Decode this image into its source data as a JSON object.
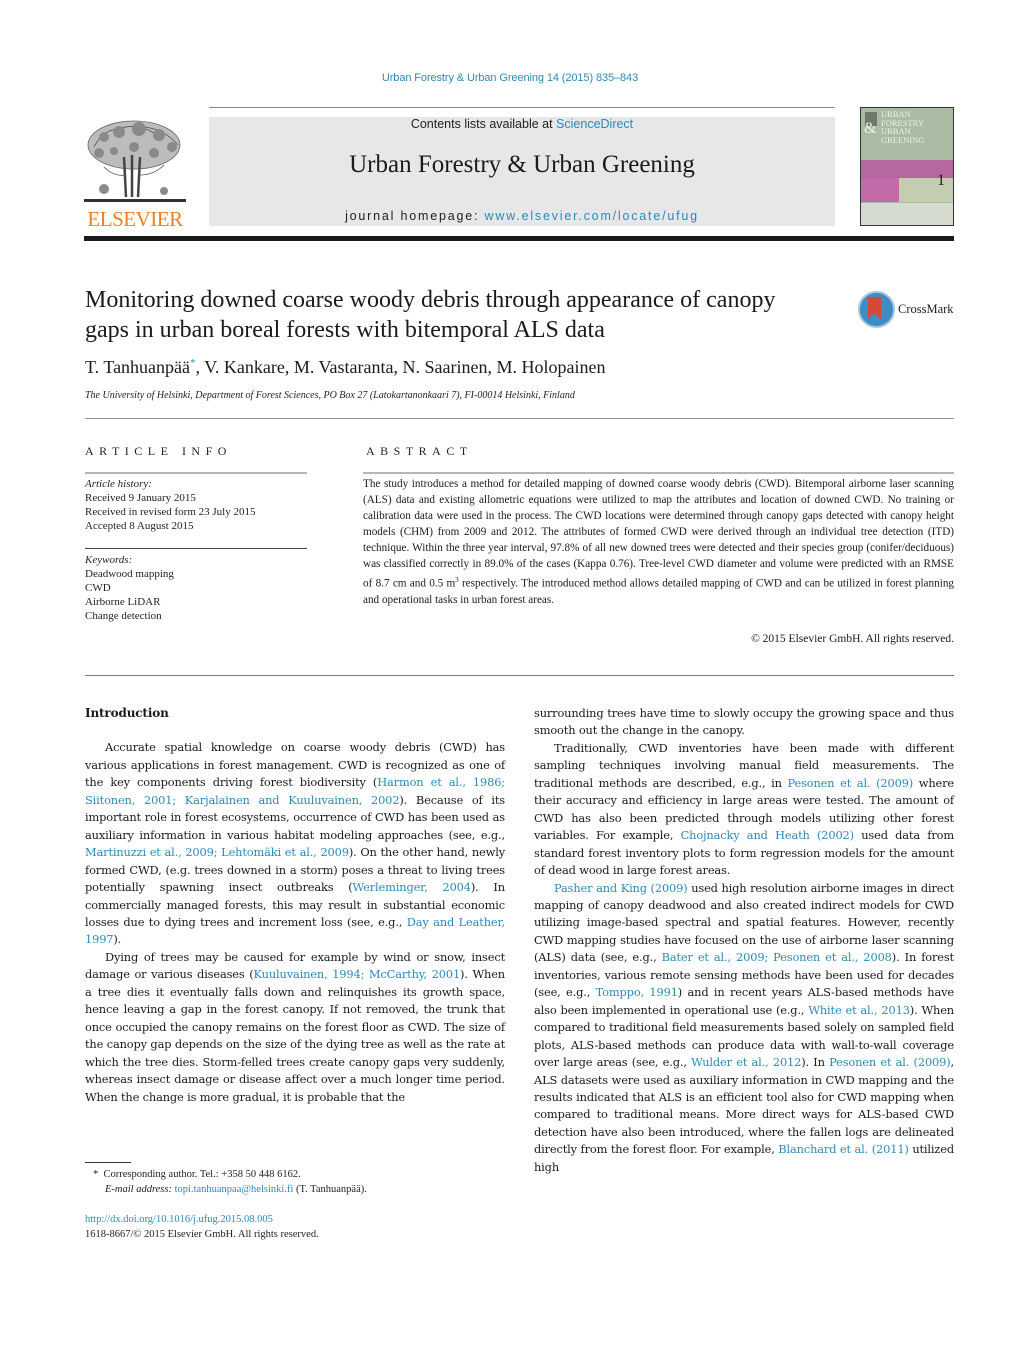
{
  "journal_ref": "Urban Forestry & Urban Greening 14 (2015) 835–843",
  "publisher": {
    "logo_word": "ELSEVIER",
    "brand_color": "#f07f1e"
  },
  "banner": {
    "contents_prefix": "Contents lists available at ",
    "contents_link": "ScienceDirect",
    "journal_title": "Urban Forestry & Urban Greening",
    "homepage_prefix": "journal homepage: ",
    "homepage_link": "www.elsevier.com/locate/ufug"
  },
  "cover": {
    "title_lines": [
      "URBAN",
      "FORESTRY",
      "URBAN",
      "GREENING"
    ],
    "amp": "&",
    "issue_number": "1"
  },
  "crossmark": {
    "label": "CrossMark"
  },
  "article": {
    "title": "Monitoring downed coarse woody debris through appearance of canopy gaps in urban boreal forests with bitemporal ALS data",
    "authors": [
      {
        "name": "T. Tanhuanpää",
        "corresponding": true
      },
      {
        "name": "V. Kankare"
      },
      {
        "name": "M. Vastaranta"
      },
      {
        "name": "N. Saarinen"
      },
      {
        "name": "M. Holopainen"
      }
    ],
    "authors_line_first": "T. Tanhuanpää",
    "authors_star": "*",
    "authors_line_rest": ", V. Kankare, M. Vastaranta, N. Saarinen, M. Holopainen",
    "affiliation": "The University of Helsinki, Department of Forest Sciences, PO Box 27 (Latokartanonkaari 7), FI-00014 Helsinki, Finland"
  },
  "article_info": {
    "heading": "ARTICLE INFO",
    "history_label": "Article history:",
    "history": [
      "Received 9 January 2015",
      "Received in revised form 23 July 2015",
      "Accepted 8 August 2015"
    ],
    "keywords_label": "Keywords:",
    "keywords": [
      "Deadwood mapping",
      "CWD",
      "Airborne LiDAR",
      "Change detection"
    ]
  },
  "abstract": {
    "heading": "ABSTRACT",
    "text_part1": "The study introduces a method for detailed mapping of downed coarse woody debris (CWD). Bitemporal airborne laser scanning (ALS) data and existing allometric equations were utilized to map the attributes and location of downed CWD. No training or calibration data were used in the process. The CWD locations were determined through canopy gaps detected with canopy height models (CHM) from 2009 and 2012. The attributes of formed CWD were derived through an individual tree detection (ITD) technique. Within the three year interval, 97.8% of all new downed trees were detected and their species group (conifer/deciduous) was classified correctly in 89.0% of the cases (Kappa 0.76). Tree-level CWD diameter and volume were predicted with an RMSE of 8.7 cm and 0.5 m",
    "superscript": "3",
    "text_part2": " respectively. The introduced method allows detailed mapping of CWD and can be utilized in forest planning and operational tasks in urban forest areas.",
    "copyright": "© 2015 Elsevier GmbH. All rights reserved."
  },
  "body": {
    "intro_heading": "Introduction",
    "left": [
      [
        {
          "t": "Accurate spatial knowledge on coarse woody debris (CWD) has various applications in forest management. CWD is recognized as one of the key components driving forest biodiversity ("
        },
        {
          "t": "Harmon et al., 1986; Siitonen, 2001; Karjalainen and Kuuluvainen, 2002",
          "link": true
        },
        {
          "t": "). Because of its important role in forest ecosystems, occurrence of CWD has been used as auxiliary information in various habitat modeling approaches (see, e.g., "
        },
        {
          "t": "Martinuzzi et al., 2009; Lehtomäki et al., 2009",
          "link": true
        },
        {
          "t": "). On the other hand, newly formed CWD, (e.g. trees downed in a storm) poses a threat to living trees potentially spawning insect outbreaks ("
        },
        {
          "t": "Werleminger, 2004",
          "link": true
        },
        {
          "t": "). In commercially managed forests, this may result in substantial economic losses due to dying trees and increment loss (see, e.g., "
        },
        {
          "t": "Day and Leather, 1997",
          "link": true
        },
        {
          "t": ")."
        }
      ],
      [
        {
          "t": "Dying of trees may be caused for example by wind or snow, insect damage or various diseases ("
        },
        {
          "t": "Kuuluvainen, 1994; McCarthy, 2001",
          "link": true
        },
        {
          "t": "). When a tree dies it eventually falls down and relinquishes its growth space, hence leaving a gap in the forest canopy. If not removed, the trunk that once occupied the canopy remains on the forest floor as CWD. The size of the canopy gap depends on the size of the dying tree as well as the rate at which the tree dies. Storm-felled trees create canopy gaps very suddenly, whereas insect damage or disease affect over a much longer time period. When the change is more gradual, it is probable that the"
        }
      ]
    ],
    "right": [
      [
        {
          "t": "surrounding trees have time to slowly occupy the growing space and thus smooth out the change in the canopy."
        }
      ],
      [
        {
          "t": "Traditionally, CWD inventories have been made with different sampling techniques involving manual field measurements. The traditional methods are described, e.g., in "
        },
        {
          "t": "Pesonen et al. (2009)",
          "link": true
        },
        {
          "t": " where their accuracy and efficiency in large areas were tested. The amount of CWD has also been predicted through models utilizing other forest variables. For example, "
        },
        {
          "t": "Chojnacky and Heath (2002)",
          "link": true
        },
        {
          "t": " used data from standard forest inventory plots to form regression models for the amount of dead wood in large forest areas."
        }
      ],
      [
        {
          "t": "Pasher and King (2009)",
          "link": true
        },
        {
          "t": " used high resolution airborne images in direct mapping of canopy deadwood and also created indirect models for CWD utilizing image-based spectral and spatial features. However, recently CWD mapping studies have focused on the use of airborne laser scanning (ALS) data (see, e.g., "
        },
        {
          "t": "Bater et al., 2009; Pesonen et al., 2008",
          "link": true
        },
        {
          "t": "). In forest inventories, various remote sensing methods have been used for decades (see, e.g., "
        },
        {
          "t": "Tomppo, 1991",
          "link": true
        },
        {
          "t": ") and in recent years ALS-based methods have also been implemented in operational use (e.g., "
        },
        {
          "t": "White et al., 2013",
          "link": true
        },
        {
          "t": "). When compared to traditional field measurements based solely on sampled field plots, ALS-based methods can produce data with wall-to-wall coverage over large areas (see, e.g., "
        },
        {
          "t": "Wulder et al., 2012",
          "link": true
        },
        {
          "t": "). In "
        },
        {
          "t": "Pesonen et al. (2009)",
          "link": true
        },
        {
          "t": ", ALS datasets were used as auxiliary information in CWD mapping and the results indicated that ALS is an efficient tool also for CWD mapping when compared to traditional means. More direct ways for ALS-based CWD detection have also been introduced, where the fallen logs are delineated directly from the forest floor. For example, "
        },
        {
          "t": "Blanchard et al. (2011)",
          "link": true
        },
        {
          "t": " utilized high"
        }
      ]
    ]
  },
  "footnote": {
    "star": "*",
    "corresponding": "Corresponding author. Tel.: +358 50 448 6162.",
    "email_label": "E-mail address:",
    "email": "topi.tanhuanpaa@helsinki.fi",
    "email_suffix": " (T. Tanhuanpää)."
  },
  "doi": {
    "link": "http://dx.doi.org/10.1016/j.ufug.2015.08.005",
    "issn_line": "1618-8667/© 2015 Elsevier GmbH. All rights reserved."
  },
  "colors": {
    "link": "#2a8ab8",
    "banner_bg": "#e6e7e8",
    "elsevier_orange": "#f07f1e"
  }
}
